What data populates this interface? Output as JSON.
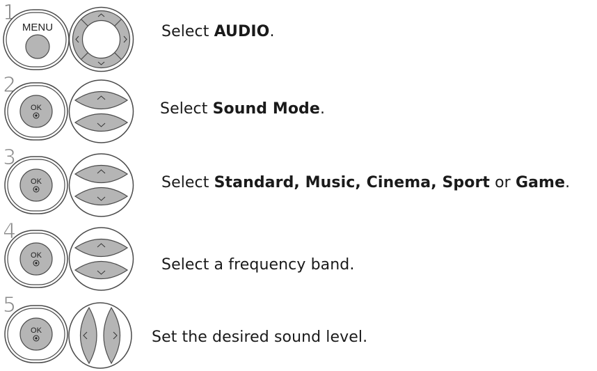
{
  "steps": [
    {
      "number": "1",
      "left_button": {
        "icon": "menu-button-icon",
        "label": "MENU"
      },
      "right_button": {
        "icon": "four-way-navigation-pad-icon"
      },
      "text_prefix": "Select ",
      "text_bold": "AUDIO",
      "text_suffix": "."
    },
    {
      "number": "2",
      "left_button": {
        "icon": "ok-button-icon",
        "label": "OK"
      },
      "right_button": {
        "icon": "up-down-buttons-icon"
      },
      "text_prefix": " Select ",
      "text_bold": "Sound Mode",
      "text_suffix": "."
    },
    {
      "number": "3",
      "left_button": {
        "icon": "ok-button-icon",
        "label": "OK"
      },
      "right_button": {
        "icon": "up-down-buttons-icon"
      },
      "text_prefix": "Select ",
      "text_bold_1": "Standard, Music, Cinema, Sport",
      "text_mid": " or ",
      "text_bold_2": "Game",
      "text_suffix": "."
    },
    {
      "number": "4",
      "left_button": {
        "icon": "ok-button-icon",
        "label": "OK"
      },
      "right_button": {
        "icon": "up-down-buttons-icon"
      },
      "text": "Select a frequency band."
    },
    {
      "number": "5",
      "left_button": {
        "icon": "ok-button-icon",
        "label": "OK"
      },
      "right_button": {
        "icon": "left-right-buttons-icon"
      },
      "text": "Set the desired sound level."
    }
  ],
  "colors": {
    "button_fill": "#b5b5b5",
    "button_outline": "#4a4a4a",
    "number": "#8a8a8a"
  }
}
